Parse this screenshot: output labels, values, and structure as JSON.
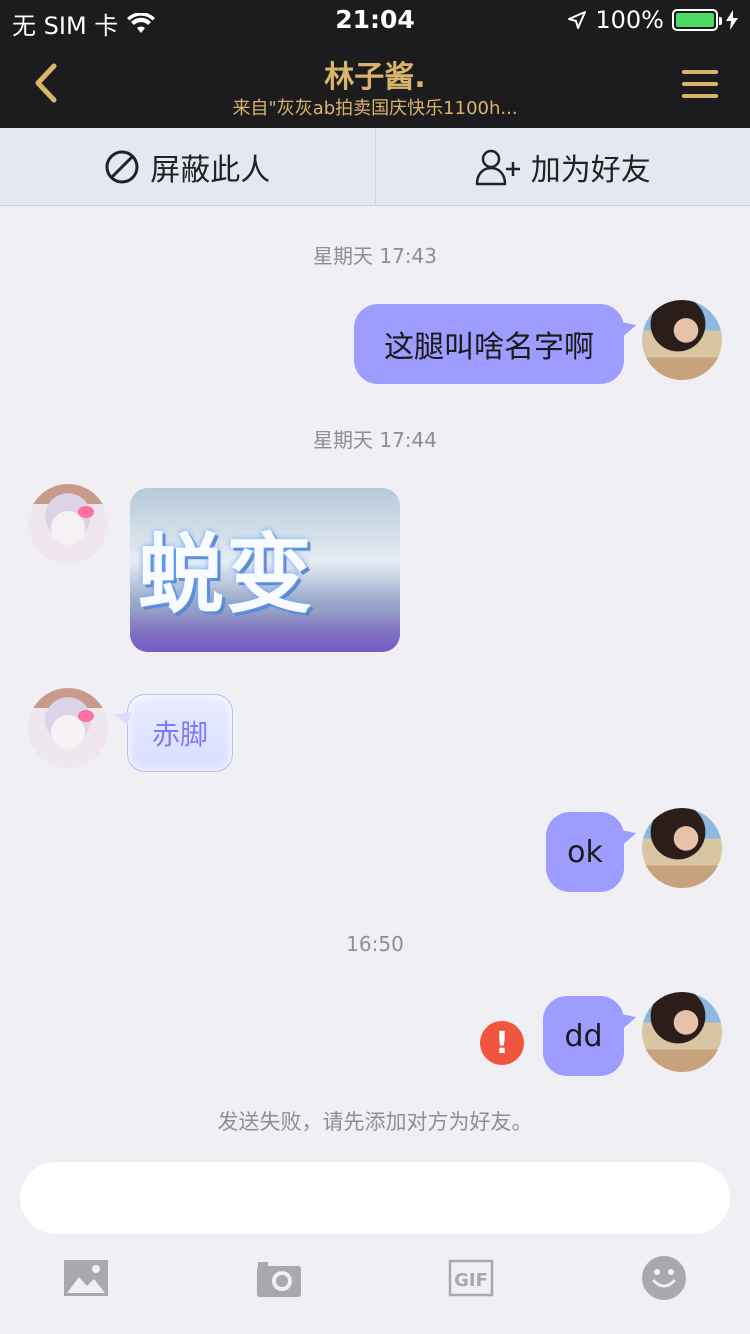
{
  "status_bar": {
    "carrier": "无 SIM 卡",
    "time": "21:04",
    "battery": "100%",
    "battery_level": 1.0,
    "battery_color": "#4cd964"
  },
  "nav": {
    "title": "林子酱.",
    "subtitle": "来自\"灰灰ab拍卖国庆快乐1100h...",
    "accent_color": "#d9b46a"
  },
  "actions": {
    "block_label": "屏蔽此人",
    "add_friend_label": "加为好友"
  },
  "messages": {
    "ts1": "星期天 17:43",
    "msg1": "这腿叫啥名字啊",
    "ts2": "星期天 17:44",
    "sticker_text": "蜕变",
    "msg3": "赤脚",
    "msg4": "ok",
    "ts3": "16:50",
    "msg5": "dd",
    "error_mark": "!",
    "system_note": "发送失败，请先添加对方为好友。"
  },
  "composer": {
    "placeholder": "",
    "tools": [
      "image-icon",
      "camera-icon",
      "gif-icon",
      "emoji-icon"
    ],
    "gif_label": "GIF"
  }
}
